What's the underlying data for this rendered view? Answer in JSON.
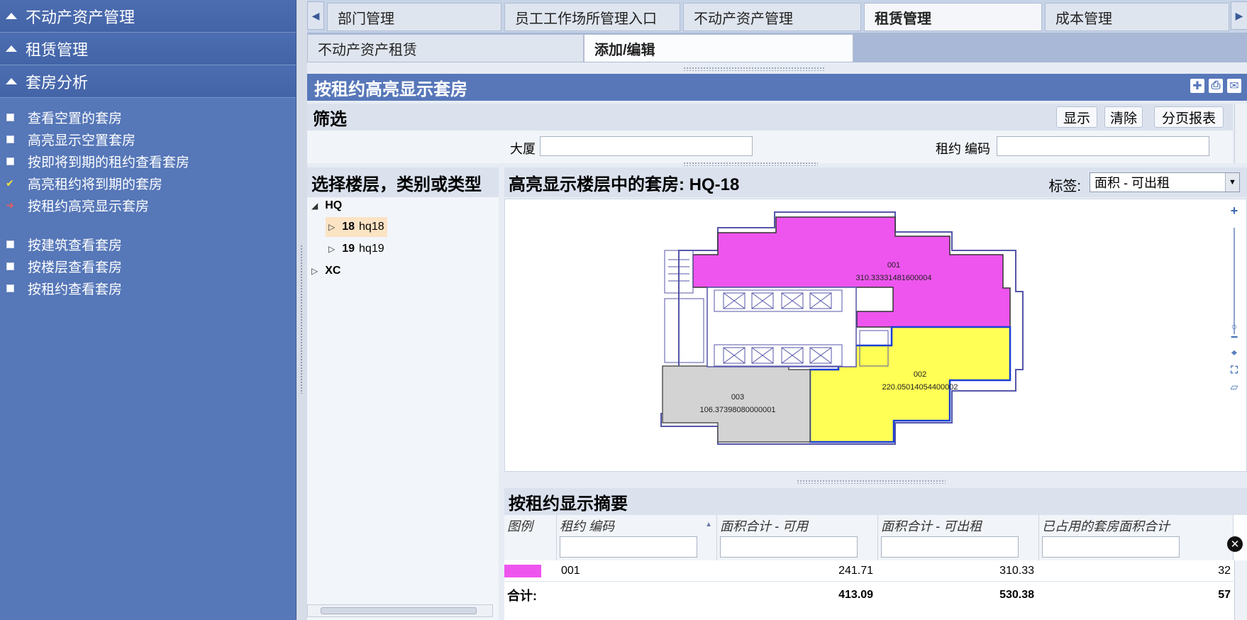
{
  "sidebar": {
    "sections": [
      {
        "label": "不动产资产管理"
      },
      {
        "label": "租赁管理"
      },
      {
        "label": "套房分析"
      }
    ],
    "items": [
      {
        "label": "查看空置的套房",
        "marker": "square"
      },
      {
        "label": "高亮显示空置套房",
        "marker": "square"
      },
      {
        "label": "按即将到期的租约查看套房",
        "marker": "square"
      },
      {
        "label": "高亮租约将到期的套房",
        "marker": "check"
      },
      {
        "label": "按租约高亮显示套房",
        "marker": "arrow"
      }
    ],
    "items2": [
      {
        "label": "按建筑查看套房",
        "marker": "square"
      },
      {
        "label": "按楼层查看套房",
        "marker": "square"
      },
      {
        "label": "按租约查看套房",
        "marker": "square"
      }
    ]
  },
  "tabs": [
    {
      "label": "部门管理"
    },
    {
      "label": "员工工作场所管理入口"
    },
    {
      "label": "不动产资产管理"
    },
    {
      "label": "租赁管理",
      "active": true
    },
    {
      "label": "成本管理"
    }
  ],
  "subtabs": [
    {
      "label": "不动产资产租赁"
    },
    {
      "label": "添加/编辑",
      "active": true
    }
  ],
  "panel": {
    "title": "按租约高亮显示套房"
  },
  "filter": {
    "title": "筛选",
    "buttons": {
      "show": "显示",
      "clear": "清除",
      "paged_report": "分页报表"
    },
    "building_label": "大厦",
    "building_value": "",
    "lease_label": "租约 编码",
    "lease_value": ""
  },
  "tree": {
    "title": "选择楼层，类别或类型",
    "nodes": [
      {
        "code": "HQ",
        "name": "",
        "expanded": true
      },
      {
        "code": "18",
        "name": "hq18",
        "selected": true
      },
      {
        "code": "19",
        "name": "hq19"
      },
      {
        "code": "XC",
        "name": ""
      }
    ]
  },
  "map": {
    "title": "高亮显示楼层中的套房: HQ-18",
    "label_caption": "标签:",
    "label_value": "面积 - 可出租",
    "rooms": [
      {
        "id": "001",
        "area": "310.33331481600004",
        "color": "#ee55ee"
      },
      {
        "id": "002",
        "area": "220.05014054400002",
        "color": "#ffff55"
      },
      {
        "id": "003",
        "area": "106.37398080000001",
        "color": "#d3d3d3"
      }
    ]
  },
  "summary": {
    "title": "按租约显示摘要",
    "columns": [
      "图例",
      "租约 编码",
      "面积合计 - 可用",
      "面积合计 - 可出租",
      "已占用的套房面积合计"
    ],
    "rows": [
      {
        "color": "#ee55ee",
        "lease": "001",
        "usable": "241.71",
        "rentable": "310.33",
        "occupied": "32"
      }
    ],
    "total": {
      "label": "合计:",
      "usable": "413.09",
      "rentable": "530.38",
      "occupied": "57"
    }
  }
}
